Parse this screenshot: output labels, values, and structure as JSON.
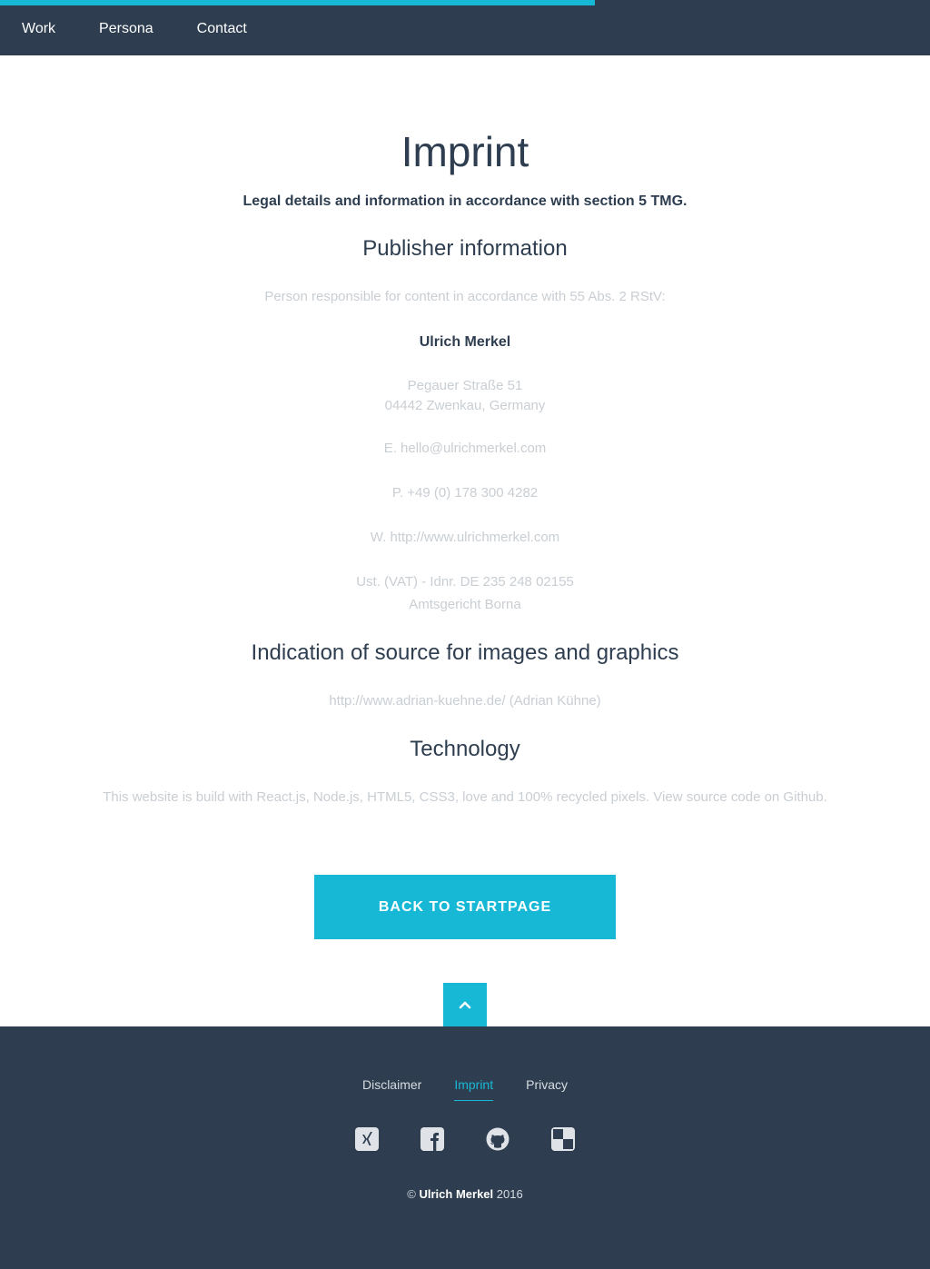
{
  "header": {
    "nav": [
      "Work",
      "Persona",
      "Contact"
    ],
    "progress_fraction": 0.64
  },
  "main": {
    "title": "Imprint",
    "subtitle": "Legal details and information in accordance with section 5 TMG.",
    "publisher_heading": "Publisher information",
    "responsible_text": "Person responsible for content in accordance with 55 Abs. 2 RStV:",
    "name": "Ulrich Merkel",
    "address_line1": "Pegauer Straße 51",
    "address_line2": "04442 Zwenkau, Germany",
    "email": "E. hello@ulrichmerkel.com",
    "phone": "P. +49 (0) 178 300 4282",
    "web": "W. http://www.ulrichmerkel.com",
    "vat": "Ust. (VAT) - Idnr. DE 235 248 02155",
    "court": "Amtsgericht Borna",
    "images_heading": "Indication of source for images and graphics",
    "images_source": "http://www.adrian-kuehne.de/ (Adrian Kühne)",
    "tech_heading": "Technology",
    "tech_text": "This website is build with React.js, Node.js, HTML5, CSS3, love and 100% recycled pixels. View source code on Github.",
    "cta_label": "BACK TO STARTPAGE"
  },
  "footer": {
    "links": [
      "Disclaimer",
      "Imprint",
      "Privacy"
    ],
    "active_link": "Imprint",
    "social_icons": [
      "xing-icon",
      "facebook-icon",
      "github-icon",
      "delicious-icon"
    ],
    "copyright_symbol": "©",
    "copyright_name": "Ulrich Merkel",
    "copyright_year": "2016"
  },
  "colors": {
    "dark": "#2e3e50",
    "accent": "#17b8d6",
    "muted_text": "#c9ced3",
    "footer_text": "#d7dce0"
  }
}
